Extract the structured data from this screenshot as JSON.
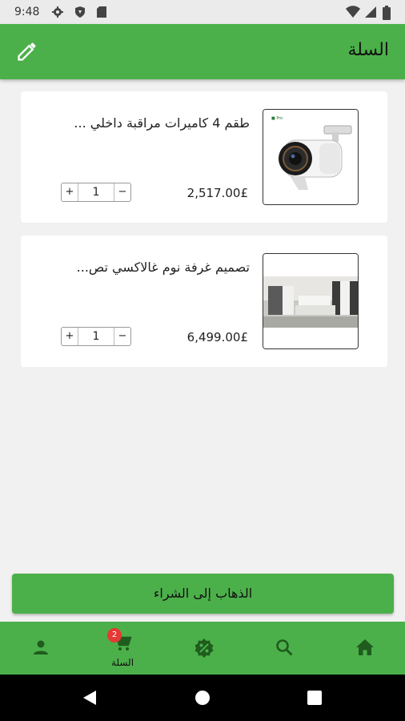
{
  "status_bar": {
    "time": "9:48",
    "icons": [
      "settings-icon",
      "shield-icon",
      "sd-card-icon",
      "wifi-icon",
      "signal-icon",
      "battery-icon"
    ]
  },
  "app_bar": {
    "title": "السلة",
    "action_icon": "edit-icon",
    "background": "#4cb04a"
  },
  "cart": {
    "items": [
      {
        "name": "طقم 4 كاميرات مراقبة داخلي ...",
        "price": "2,517.00£",
        "quantity": "1",
        "plus": "+",
        "minus": "−",
        "image": "security-camera-image"
      },
      {
        "name": "تصميم غرفة نوم غالاكسي تص...",
        "price": "6,499.00£",
        "quantity": "1",
        "plus": "+",
        "minus": "−",
        "image": "bedroom-image"
      }
    ]
  },
  "checkout": {
    "label": "الذهاب إلى الشراء"
  },
  "bottom_nav": {
    "items": [
      {
        "icon": "account-icon",
        "label": ""
      },
      {
        "icon": "cart-icon",
        "label": "السلة",
        "badge": "2"
      },
      {
        "icon": "discount-icon",
        "label": ""
      },
      {
        "icon": "search-icon",
        "label": ""
      },
      {
        "icon": "home-icon",
        "label": ""
      }
    ]
  },
  "system_nav": {
    "icons": [
      "back-icon",
      "home-circle-icon",
      "recents-icon"
    ]
  }
}
